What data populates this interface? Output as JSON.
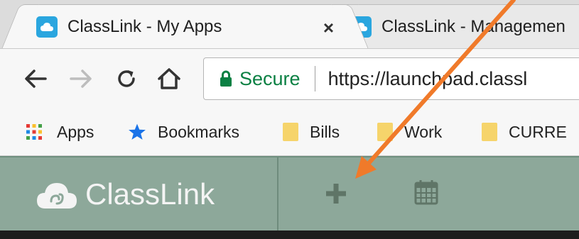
{
  "tabs": [
    {
      "title": "ClassLink - My Apps",
      "close": "×",
      "active": true
    },
    {
      "title": "ClassLink - Managemen",
      "active": false
    }
  ],
  "nav": {
    "back_icon": "back-arrow-icon",
    "forward_icon": "forward-arrow-icon",
    "reload_icon": "reload-icon",
    "home_icon": "home-icon"
  },
  "address": {
    "secure_label": "Secure",
    "url": "https://launchpad.classl"
  },
  "bookmarks": [
    {
      "label": "Apps",
      "icon": "apps-grid-icon"
    },
    {
      "label": "Bookmarks",
      "icon": "star-icon"
    },
    {
      "label": "Bills",
      "icon": "folder-icon"
    },
    {
      "label": "Work",
      "icon": "folder-icon"
    },
    {
      "label": "CURRE",
      "icon": "folder-icon"
    }
  ],
  "app": {
    "logo_text": "ClassLink",
    "add_icon": "plus-icon",
    "calendar_icon": "calendar-icon"
  },
  "colors": {
    "header_bg": "#8da89a",
    "secure_green": "#0b8043",
    "favicon_blue": "#2aa6df",
    "annotation_arrow": "#f07a2a"
  }
}
